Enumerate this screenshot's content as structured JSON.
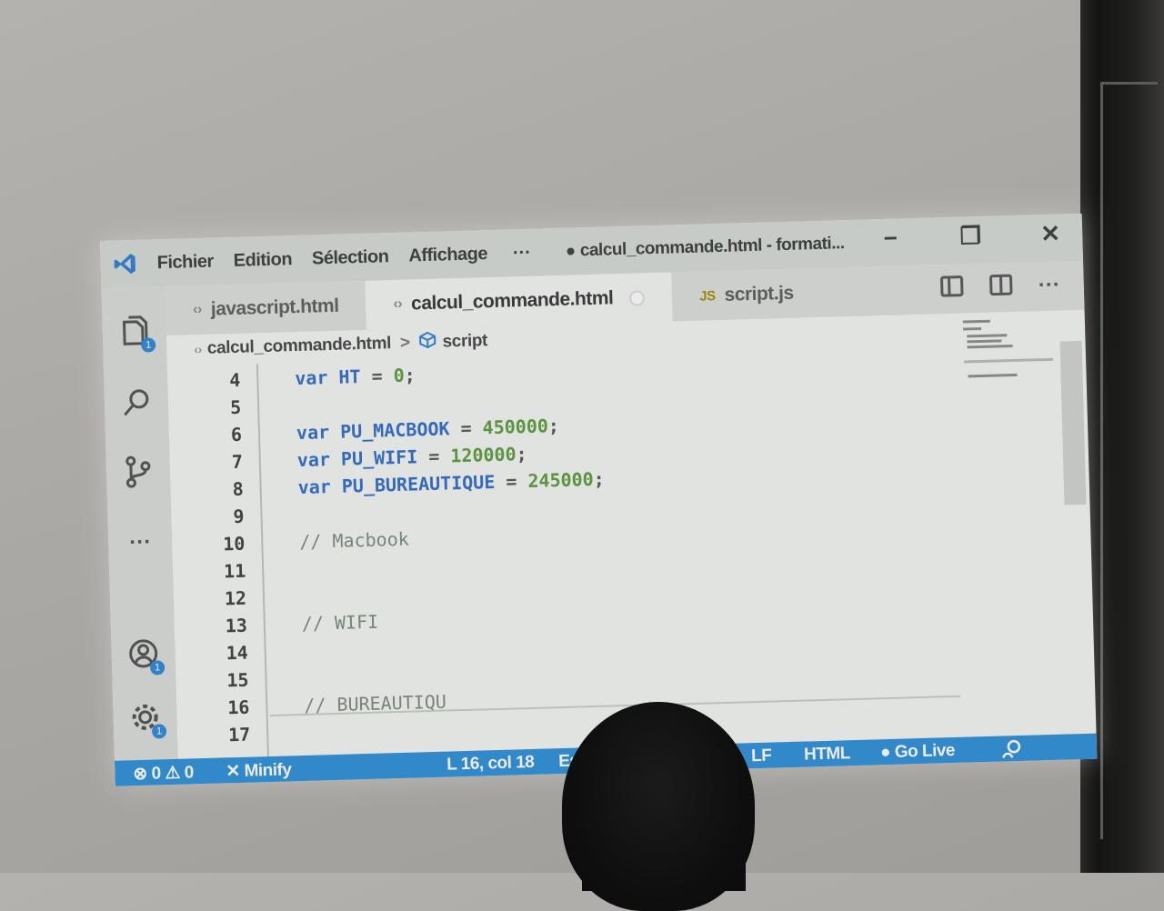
{
  "titlebar": {
    "menu": [
      "Fichier",
      "Edition",
      "Sélection",
      "Affichage"
    ],
    "more": "···",
    "title": "calcul_commande.html - formati...",
    "minimize": "−",
    "restore": "❐",
    "close": "✕"
  },
  "activity": {
    "badges": {
      "explorer": "1",
      "account": "1",
      "settings": "1"
    },
    "more": "···"
  },
  "tabs": [
    {
      "label": "javascript.html"
    },
    {
      "label": "calcul_commande.html"
    },
    {
      "label": "script.js",
      "prefix": "JS"
    }
  ],
  "breadcrumb": {
    "file": "calcul_commande.html",
    "sep": ">",
    "symbol": "script"
  },
  "editor": {
    "lines": [
      {
        "n": "4",
        "parts": [
          [
            "kw",
            "var "
          ],
          [
            "id",
            "HT"
          ],
          [
            "op",
            " = "
          ],
          [
            "num",
            "0"
          ],
          [
            "op",
            ";"
          ]
        ]
      },
      {
        "n": "5",
        "parts": []
      },
      {
        "n": "6",
        "parts": [
          [
            "kw",
            "var "
          ],
          [
            "id",
            "PU_MACBOOK"
          ],
          [
            "op",
            " = "
          ],
          [
            "num",
            "450000"
          ],
          [
            "op",
            ";"
          ]
        ]
      },
      {
        "n": "7",
        "parts": [
          [
            "kw",
            "var "
          ],
          [
            "id",
            "PU_WIFI"
          ],
          [
            "op",
            " = "
          ],
          [
            "num",
            "120000"
          ],
          [
            "op",
            ";"
          ]
        ]
      },
      {
        "n": "8",
        "parts": [
          [
            "kw",
            "var "
          ],
          [
            "id",
            "PU_BUREAUTIQUE"
          ],
          [
            "op",
            " = "
          ],
          [
            "num",
            "245000"
          ],
          [
            "op",
            ";"
          ]
        ]
      },
      {
        "n": "9",
        "parts": []
      },
      {
        "n": "10",
        "parts": [
          [
            "cm",
            "// Macbook"
          ]
        ]
      },
      {
        "n": "11",
        "parts": []
      },
      {
        "n": "12",
        "parts": []
      },
      {
        "n": "13",
        "parts": [
          [
            "cm",
            "// WIFI"
          ]
        ]
      },
      {
        "n": "14",
        "parts": []
      },
      {
        "n": "15",
        "parts": []
      },
      {
        "n": "16",
        "parts": [
          [
            "cm",
            "// BUREAUTIQU"
          ]
        ]
      },
      {
        "n": "17",
        "parts": []
      }
    ]
  },
  "statusbar": {
    "errors": "0",
    "warnings": "0",
    "minify": "Minify",
    "position": "L 16, col 18",
    "spaces": "Esp",
    "eol": "LF",
    "language": "HTML",
    "golive": "Go Live"
  },
  "colors": {
    "statusbar": "#2b8fd8",
    "keyword": "#2f6bc8",
    "number": "#5a9a3c",
    "comment": "#7a8a7a",
    "editor_bg": "#f4f6f4"
  }
}
